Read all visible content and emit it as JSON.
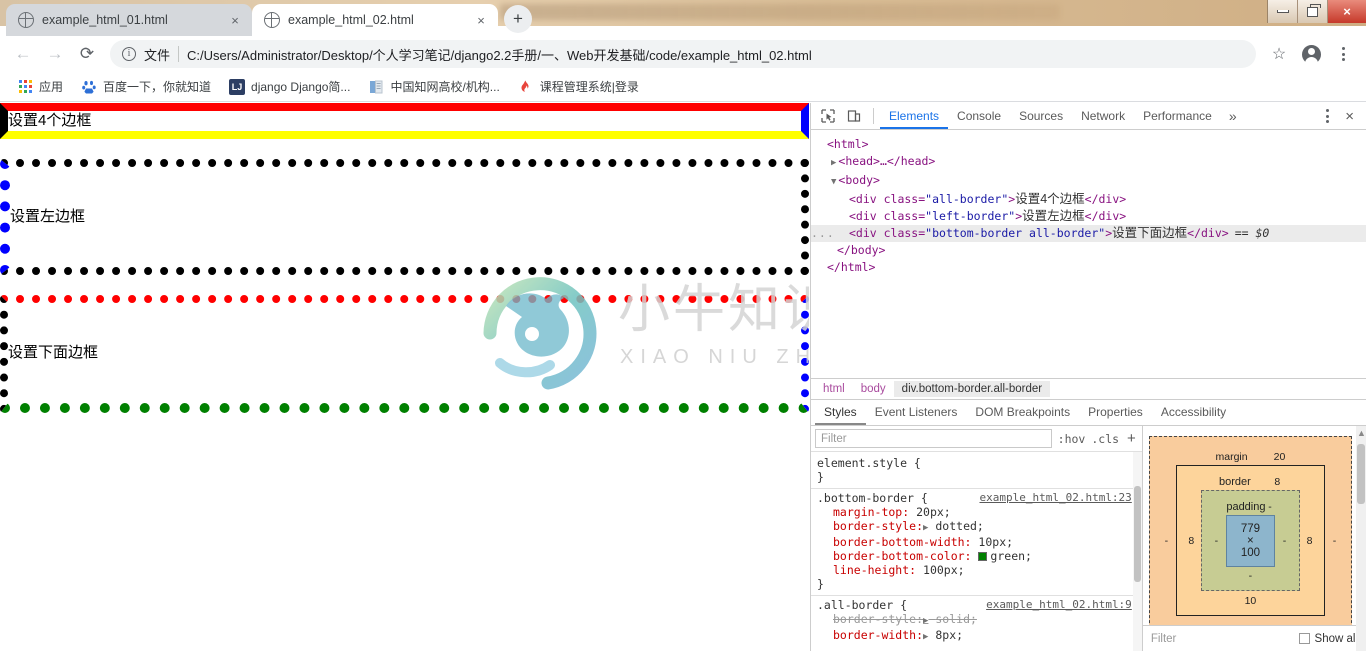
{
  "window": {
    "minimize_label": "minimize",
    "maximize_label": "restore",
    "close_label": "×"
  },
  "tabs": [
    {
      "title": "example_html_01.html",
      "favicon": "globe-icon",
      "close": "×",
      "active": false
    },
    {
      "title": "example_html_02.html",
      "favicon": "globe-icon",
      "close": "×",
      "active": true
    }
  ],
  "newtab_label": "+",
  "toolbar": {
    "back": "←",
    "forward": "→",
    "reload": "⟳",
    "info_icon": "i",
    "scheme_label": "文件",
    "url": "C:/Users/Administrator/Desktop/个人学习笔记/django2.2手册/一、Web开发基础/code/example_html_02.html",
    "bookmark_star": "☆",
    "profile": "avatar-icon",
    "menu": "kebab-icon"
  },
  "bookmarks": [
    {
      "label": "应用",
      "icon": "apps-grid-icon"
    },
    {
      "label": "百度一下，你就知道",
      "icon": "baidu-icon"
    },
    {
      "label": "django Django简...",
      "icon": "lj-icon"
    },
    {
      "label": "中国知网高校/机构...",
      "icon": "cnki-icon"
    },
    {
      "label": "课程管理系统|登录",
      "icon": "flame-icon"
    }
  ],
  "page": {
    "div_all_border_text": "设置4个边框",
    "div_left_border_text": "设置左边框",
    "div_bottom_border_text": "设置下面边框",
    "watermark_cn": "小牛知识库",
    "watermark_en": "XIAO NIU ZHI SHI KU",
    "colors": {
      "top": "#ff0000",
      "right": "#0000ff",
      "bottom_yellow": "#ffff00",
      "bottom_green": "#008000",
      "left": "#000000"
    }
  },
  "devtools": {
    "inspect_icon": "inspect-cursor-icon",
    "device_icon": "device-toolbar-icon",
    "tabs": [
      {
        "label": "Elements",
        "selected": true
      },
      {
        "label": "Console",
        "selected": false
      },
      {
        "label": "Sources",
        "selected": false
      },
      {
        "label": "Network",
        "selected": false
      },
      {
        "label": "Performance",
        "selected": false
      }
    ],
    "more_tabs": "»",
    "settings_icon": "kebab-icon",
    "close_icon": "×",
    "dom": [
      {
        "indent": 0,
        "arrow": "",
        "html": "&lt;html&gt;"
      },
      {
        "indent": 1,
        "arrow": "▶",
        "html": "&lt;head&gt;…&lt;/head&gt;"
      },
      {
        "indent": 1,
        "arrow": "▼",
        "html": "&lt;body&gt;"
      },
      {
        "indent": 2,
        "arrow": "",
        "html": "div all-border 设置4个边框"
      },
      {
        "indent": 2,
        "arrow": "",
        "html": "div left-border 设置左边框"
      },
      {
        "indent": 2,
        "arrow": "",
        "html": "div bottom-border all-border 设置下面边框"
      },
      {
        "indent": 1,
        "arrow": "",
        "html": "&lt;/body&gt;"
      },
      {
        "indent": 0,
        "arrow": "",
        "html": "&lt;/html&gt;"
      }
    ],
    "dom_lines": {
      "l1": "<html>",
      "l2": "<head>…</head>",
      "l3": "<body>",
      "l4_tag_open": "<div class=",
      "l4_class": "\"all-border\"",
      "l4_gt": ">",
      "l4_text": "设置4个边框",
      "l4_close": "</div>",
      "l5_class": "\"left-border\"",
      "l5_text": "设置左边框",
      "l6_class": "\"bottom-border all-border\"",
      "l6_text": "设置下面边框",
      "l6_suffix": "== $0",
      "l7": "</body>",
      "l8": "</html>",
      "ellipsis": "..."
    },
    "breadcrumb": [
      {
        "label": "html",
        "selected": false
      },
      {
        "label": "body",
        "selected": false
      },
      {
        "label": "div.bottom-border.all-border",
        "selected": true
      }
    ],
    "pane_tabs": [
      {
        "label": "Styles",
        "selected": true
      },
      {
        "label": "Event Listeners",
        "selected": false
      },
      {
        "label": "DOM Breakpoints",
        "selected": false
      },
      {
        "label": "Properties",
        "selected": false
      },
      {
        "label": "Accessibility",
        "selected": false
      }
    ],
    "styles_filter_placeholder": "Filter",
    "hov_label": ":hov",
    "cls_label": ".cls",
    "plus_label": "+",
    "rules": [
      {
        "selector": "element.style {",
        "source": "",
        "close": "}",
        "props": []
      },
      {
        "selector": ".bottom-border {",
        "source": "example_html_02.html:23",
        "close": "}",
        "props": [
          {
            "name": "margin-top:",
            "value": "20px;",
            "struck": false,
            "expand": false,
            "swatch": ""
          },
          {
            "name": "border-style:",
            "value": "dotted;",
            "struck": false,
            "expand": true,
            "swatch": ""
          },
          {
            "name": "border-bottom-width:",
            "value": "10px;",
            "struck": false,
            "expand": false,
            "swatch": ""
          },
          {
            "name": "border-bottom-color:",
            "value": "green;",
            "struck": false,
            "expand": false,
            "swatch": "#008000"
          },
          {
            "name": "line-height:",
            "value": "100px;",
            "struck": false,
            "expand": false,
            "swatch": ""
          }
        ]
      },
      {
        "selector": ".all-border {",
        "source": "example_html_02.html:9",
        "close": "",
        "props": [
          {
            "name": "border-style:",
            "value": "solid;",
            "struck": true,
            "expand": true,
            "swatch": ""
          },
          {
            "name": "border-width:",
            "value": "8px;",
            "struck": false,
            "expand": true,
            "swatch": ""
          }
        ]
      }
    ],
    "boxmodel": {
      "margin_label": "margin",
      "margin_top": "20",
      "margin_right": "-",
      "margin_bottom": "-",
      "margin_left": "-",
      "border_label": "border",
      "border_top": "8",
      "border_right": "8",
      "border_bottom": "10",
      "border_left": "8",
      "padding_label": "padding",
      "padding_top": "-",
      "padding_right": "-",
      "padding_bottom": "-",
      "padding_left": "-",
      "content": "779 × 100"
    },
    "computed_filter_placeholder": "Filter",
    "show_all_label": "Show all"
  }
}
